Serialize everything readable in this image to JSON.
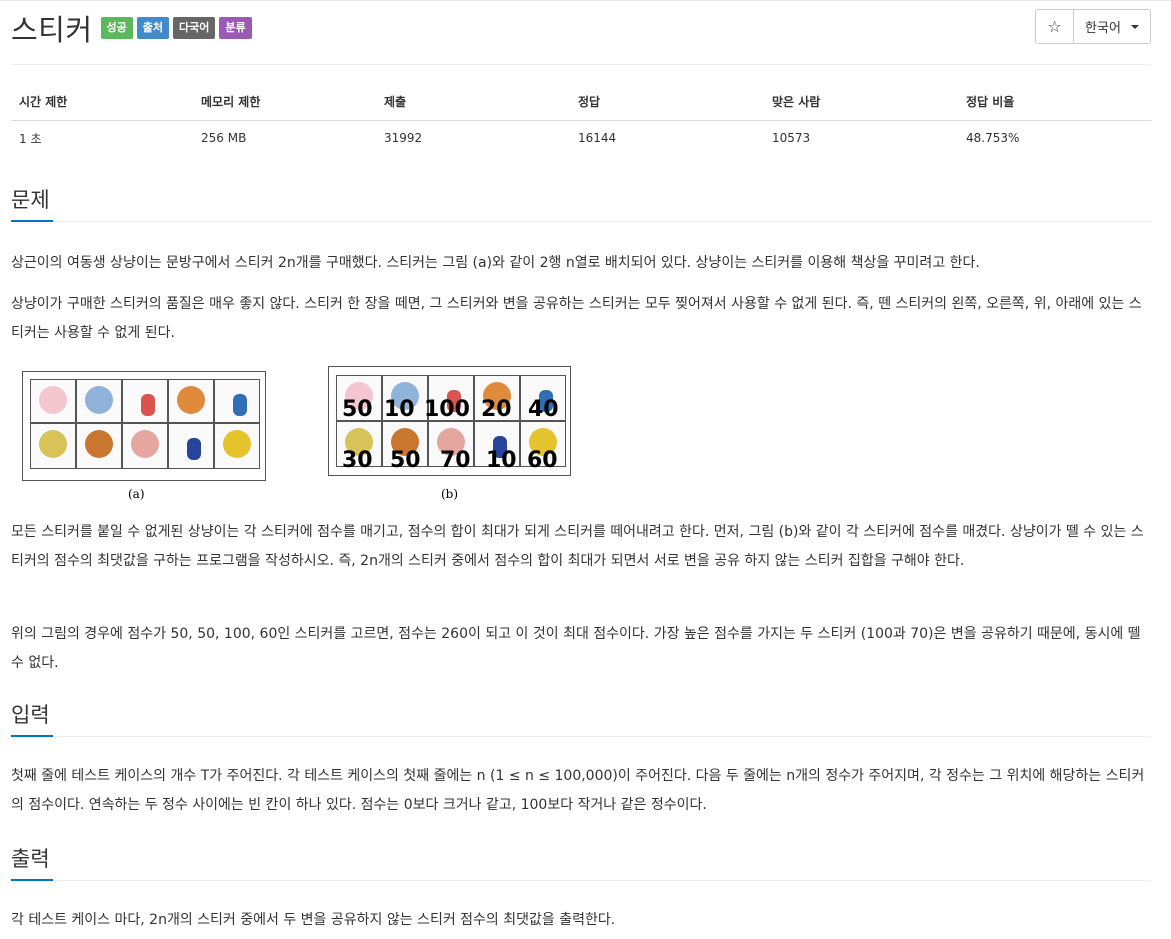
{
  "header": {
    "title": "스티커",
    "badges": [
      {
        "label": "성공",
        "color": "#5cb85c"
      },
      {
        "label": "출처",
        "color": "#428bca"
      },
      {
        "label": "다국어",
        "color": "#666666"
      },
      {
        "label": "분류",
        "color": "#9b59b6"
      }
    ],
    "star_label": "☆",
    "language_label": "한국어"
  },
  "stats": {
    "headers": [
      "시간 제한",
      "메모리 제한",
      "제출",
      "정답",
      "맞은 사람",
      "정답 비율"
    ],
    "values": [
      "1 초",
      "256 MB",
      "31992",
      "16144",
      "10573",
      "48.753%"
    ]
  },
  "problem": {
    "heading": "문제",
    "p1": "상근이의 여동생 상냥이는 문방구에서 스티커 2n개를 구매했다. 스티커는 그림 (a)와 같이 2행 n열로 배치되어 있다. 상냥이는 스티커를 이용해 책상을 꾸미려고 한다.",
    "p2": "상냥이가 구매한 스티커의 품질은 매우 좋지 않다. 스티커 한 장을 떼면, 그 스티커와 변을 공유하는 스티커는 모두 찢어져서 사용할 수 없게 된다. 즉, 뗀 스티커의 왼쪽, 오른쪽, 위, 아래에 있는 스티커는 사용할 수 없게 된다.",
    "p3": "모든 스티커를 붙일 수 없게된 상냥이는 각 스티커에 점수를 매기고, 점수의 합이 최대가 되게 스티커를 떼어내려고 한다. 먼저, 그림 (b)와 같이 각 스티커에 점수를 매겼다. 상냥이가 뗄 수 있는 스티커의 점수의 최댓값을 구하는 프로그램을 작성하시오. 즉, 2n개의 스티커 중에서 점수의 합이 최대가 되면서 서로 변을 공유 하지 않는 스티커 집합을 구해야 한다.",
    "p4": "위의 그림의 경우에 점수가 50, 50, 100, 60인 스티커를 고르면, 점수는 260이 되고 이 것이 최대 점수이다. 가장 높은 점수를 가지는 두 스티커 (100과 70)은 변을 공유하기 때문에, 동시에 뗄 수 없다."
  },
  "figure": {
    "caption_a": "(a)",
    "caption_b": "(b)",
    "scores_top": [
      "50",
      "10",
      "100",
      "20",
      "40"
    ],
    "scores_bottom": [
      "30",
      "50",
      "70",
      "10",
      "60"
    ]
  },
  "input": {
    "heading": "입력",
    "p1": "첫째 줄에 테스트 케이스의 개수 T가 주어진다. 각 테스트 케이스의 첫째 줄에는 n (1 ≤ n ≤ 100,000)이 주어진다. 다음 두 줄에는 n개의 정수가 주어지며, 각 정수는 그 위치에 해당하는 스티커의 점수이다. 연속하는 두 정수 사이에는 빈 칸이 하나 있다. 점수는 0보다 크거나 같고, 100보다 작거나 같은 정수이다."
  },
  "output": {
    "heading": "출력",
    "p1": "각 테스트 케이스 마다, 2n개의 스티커 중에서 두 변을 공유하지 않는 스티커 점수의 최댓값을 출력한다."
  }
}
